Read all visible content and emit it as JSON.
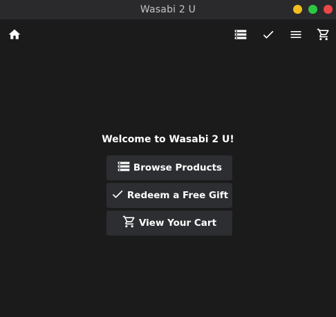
{
  "window": {
    "title": "Wasabi 2 U"
  },
  "toolbar": {
    "home_icon": "home-icon",
    "products_icon": "list-icon",
    "gift_icon": "check-icon",
    "menu_icon": "menu-icon",
    "cart_icon": "cart-icon"
  },
  "main": {
    "welcome": "Welcome to Wasabi 2 U!",
    "buttons": [
      {
        "label": "Browse Products",
        "icon": "list-icon"
      },
      {
        "label": "Redeem a Free Gift",
        "icon": "check-icon"
      },
      {
        "label": "View Your Cart",
        "icon": "cart-icon"
      }
    ]
  },
  "colors": {
    "background": "#1b1b1c",
    "titlebar": "#2a2a2d",
    "button": "#2d2e31",
    "minimize": "#f3be1d",
    "maximize": "#2dc842",
    "close": "#ef4746"
  }
}
